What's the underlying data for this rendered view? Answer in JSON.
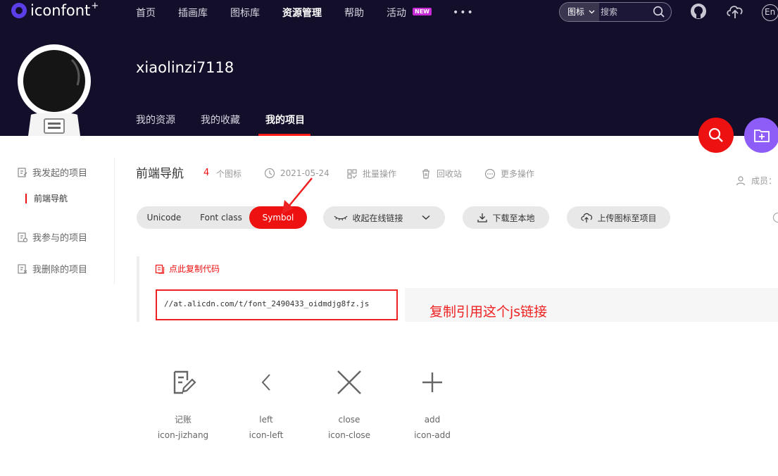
{
  "app": {
    "logo_text": "iconfont",
    "logo_plus": "+"
  },
  "topnav": {
    "links": [
      {
        "label": "首页",
        "active": false
      },
      {
        "label": "插画库",
        "active": false
      },
      {
        "label": "图标库",
        "active": false
      },
      {
        "label": "资源管理",
        "active": true
      },
      {
        "label": "帮助",
        "active": false
      },
      {
        "label": "活动",
        "active": false
      }
    ],
    "new_badge": "NEW",
    "more": "•••",
    "search": {
      "type_label": "图标",
      "placeholder": "搜索"
    },
    "lang_label": "En"
  },
  "profile": {
    "username": "xiaolinzi7118",
    "tabs": [
      {
        "label": "我的资源",
        "active": false
      },
      {
        "label": "我的收藏",
        "active": false
      },
      {
        "label": "我的项目",
        "active": true
      }
    ]
  },
  "sidebar": {
    "started": "我发起的项目",
    "current_project": "前端导航",
    "joined": "我参与的项目",
    "deleted": "我删除的项目"
  },
  "project": {
    "title": "前端导航",
    "icon_count": "4",
    "icon_count_label": "个图标",
    "date": "2021-05-24",
    "batch": "批量操作",
    "recycle": "回收站",
    "more": "更多操作",
    "members": "成员："
  },
  "formats": {
    "tabs": [
      {
        "label": "Unicode",
        "active": false
      },
      {
        "label": "Font class",
        "active": false
      },
      {
        "label": "Symbol",
        "active": true
      }
    ],
    "collapse_link": "收起在线链接",
    "download": "下载至本地",
    "upload": "上传图标至项目"
  },
  "code": {
    "copy_label": "点此复制代码",
    "url": "//at.alicdn.com/t/font_2490433_oidmdjg8fz.js"
  },
  "annotation": "复制引用这个js链接",
  "icons": [
    {
      "name": "记账",
      "code": "icon-jizhang",
      "glyph": "ledger-icon"
    },
    {
      "name": "left",
      "code": "icon-left",
      "glyph": "chevron-left-icon"
    },
    {
      "name": "close",
      "code": "icon-close",
      "glyph": "close-icon"
    },
    {
      "name": "add",
      "code": "icon-add",
      "glyph": "add-icon"
    }
  ],
  "colors": {
    "header_bg": "#130e2a",
    "accent_red": "#ee1111",
    "accent_purple": "#8e5cf7",
    "pill_bg": "#e8e8e8"
  }
}
